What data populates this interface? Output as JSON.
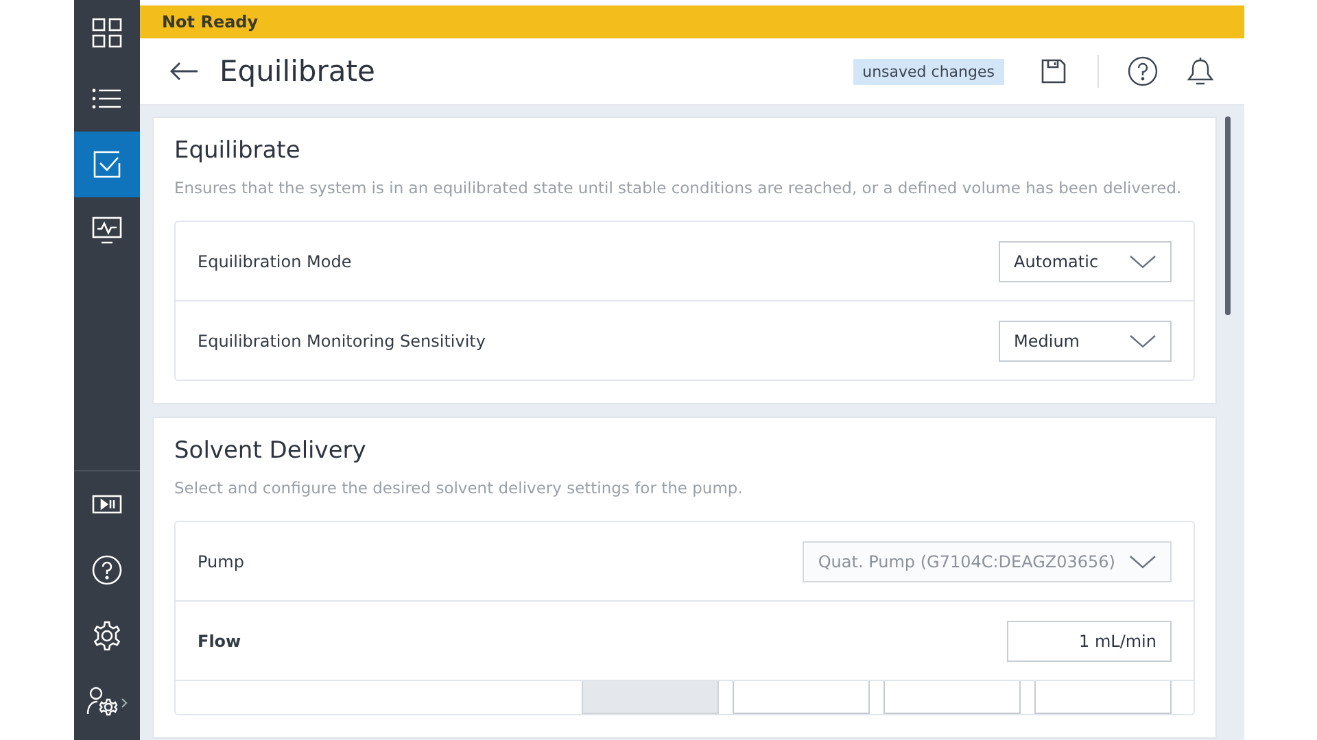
{
  "status_bar": {
    "text": "Not Ready"
  },
  "header": {
    "title": "Equilibrate",
    "badge": "unsaved changes"
  },
  "sidebar": {
    "top_items": [
      {
        "selected": false
      },
      {
        "selected": false
      },
      {
        "selected": true
      },
      {
        "selected": false
      }
    ]
  },
  "sections": [
    {
      "title": "Equilibrate",
      "description": "Ensures that the system is in an equilibrated state until stable conditions are reached, or a defined volume has been delivered.",
      "rows": [
        {
          "label": "Equilibration Mode",
          "kind": "dropdown",
          "value": "Automatic",
          "disabled": false
        },
        {
          "label": "Equilibration Monitoring Sensitivity",
          "kind": "dropdown",
          "value": "Medium",
          "disabled": false
        }
      ]
    },
    {
      "title": "Solvent Delivery",
      "description": "Select and configure the desired solvent delivery settings for the pump.",
      "rows": [
        {
          "label": "Pump",
          "kind": "dropdown",
          "value": "Quat. Pump (G7104C:DEAGZ03656)",
          "disabled": true
        },
        {
          "label": "Flow",
          "kind": "input",
          "value": "1 mL/min",
          "disabled": false
        },
        {
          "kind": "fieldgroup",
          "fields": [
            {
              "disabled": true
            },
            {
              "disabled": false
            },
            {
              "disabled": false
            },
            {
              "disabled": false
            }
          ]
        }
      ]
    }
  ]
}
